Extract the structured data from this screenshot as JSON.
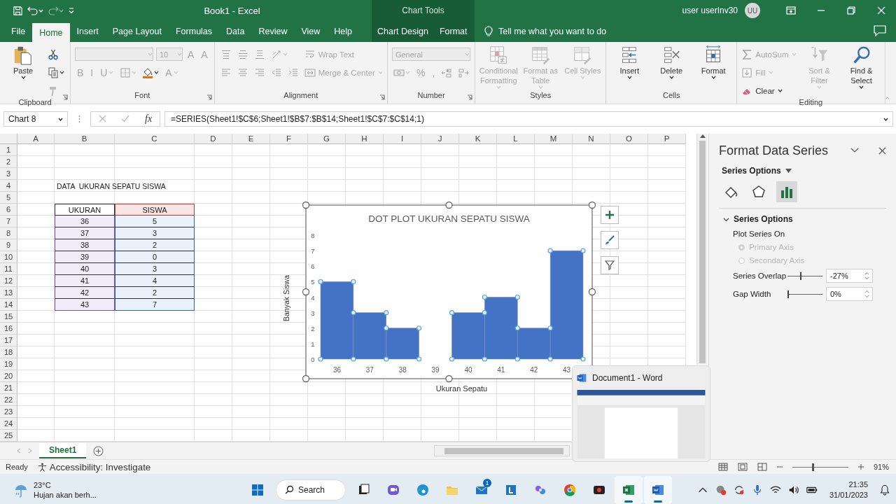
{
  "title_bar": {
    "title": "Book1  -  Excel",
    "user": "user userInv30",
    "avatar": "UU"
  },
  "tabs": [
    {
      "label": "File",
      "selected": false
    },
    {
      "label": "Home",
      "selected": true
    },
    {
      "label": "Insert",
      "selected": false
    },
    {
      "label": "Page Layout",
      "selected": false
    },
    {
      "label": "Formulas",
      "selected": false
    },
    {
      "label": "Data",
      "selected": false
    },
    {
      "label": "Review",
      "selected": false
    },
    {
      "label": "View",
      "selected": false
    },
    {
      "label": "Help",
      "selected": false
    }
  ],
  "chart_tools": {
    "label": "Chart Tools",
    "tabs": [
      {
        "label": "Chart Design",
        "selected": false
      },
      {
        "label": "Format",
        "selected": false
      }
    ]
  },
  "tell_me": {
    "placeholder": "Tell me what you want to do"
  },
  "ribbon": [
    {
      "label": "Clipboard",
      "launcher": true,
      "blocks": [
        {
          "kind": "large",
          "label": "Paste",
          "disabled": false,
          "menu": true
        },
        {
          "kind": "stack",
          "rows": [
            [
              {
                "kind": "icon",
                "disabled": false,
                "menu": false
              }
            ],
            [
              {
                "kind": "icon",
                "disabled": false,
                "menu": true
              }
            ],
            [
              {
                "kind": "icon",
                "disabled": true,
                "menu": false
              }
            ]
          ]
        }
      ]
    },
    {
      "label": "Font",
      "launcher": true,
      "blocks": [
        {
          "kind": "stack",
          "rows": [
            [
              {
                "kind": "combo",
                "disabled": true
              },
              {
                "kind": "combo",
                "label": "10",
                "disabled": true
              },
              {
                "kind": "glyph",
                "label": "A",
                "disabled": true,
                "menu": false
              },
              {
                "kind": "glyph",
                "label": "A",
                "disabled": true,
                "menu": false
              }
            ],
            [
              {
                "kind": "glyph",
                "label": "B",
                "disabled": true,
                "menu": false
              },
              {
                "kind": "glyph",
                "label": "I",
                "disabled": true,
                "menu": false
              },
              {
                "kind": "glyph",
                "label": "U",
                "disabled": true,
                "menu": true
              },
              {
                "kind": "icon",
                "disabled": true,
                "menu": true
              },
              {
                "kind": "icon",
                "disabled": false,
                "menu": true
              },
              {
                "kind": "glyph",
                "label": "A",
                "disabled": true,
                "menu": true
              }
            ]
          ]
        }
      ]
    },
    {
      "label": "Alignment",
      "launcher": true,
      "blocks": [
        {
          "kind": "stack",
          "rows": [
            [
              {
                "kind": "icon",
                "disabled": true,
                "menu": false
              },
              {
                "kind": "icon",
                "disabled": true,
                "menu": false
              },
              {
                "kind": "icon",
                "disabled": true,
                "menu": false
              },
              {
                "kind": "icon",
                "disabled": true,
                "menu": true
              }
            ],
            [
              {
                "kind": "icon",
                "disabled": true,
                "menu": false
              },
              {
                "kind": "icon",
                "disabled": true,
                "menu": false
              },
              {
                "kind": "icon",
                "disabled": true,
                "menu": false
              },
              {
                "kind": "icon",
                "disabled": true,
                "menu": false
              },
              {
                "kind": "icon",
                "disabled": true,
                "menu": false
              }
            ]
          ]
        },
        {
          "kind": "stack",
          "rows": [
            [
              {
                "kind": "small",
                "label": "Wrap Text",
                "disabled": true,
                "menu": false
              }
            ],
            [
              {
                "kind": "small",
                "label": "Merge & Center",
                "disabled": true,
                "menu": true
              }
            ]
          ]
        }
      ]
    },
    {
      "label": "Number",
      "launcher": true,
      "blocks": [
        {
          "kind": "stack",
          "rows": [
            [
              {
                "kind": "combo",
                "label": "General",
                "disabled": true
              }
            ],
            [
              {
                "kind": "icon",
                "disabled": true,
                "menu": true
              },
              {
                "kind": "glyph",
                "label": "%",
                "disabled": true,
                "menu": false
              },
              {
                "kind": "glyph",
                "label": ",",
                "disabled": true,
                "menu": false
              },
              {
                "kind": "icon",
                "disabled": true,
                "menu": false
              },
              {
                "kind": "icon",
                "disabled": true,
                "menu": false
              }
            ]
          ]
        }
      ]
    },
    {
      "label": "Styles",
      "launcher": false,
      "blocks": [
        {
          "kind": "large",
          "label": "Conditional Formatting",
          "disabled": true,
          "menu": true
        },
        {
          "kind": "large",
          "label": "Format as Table",
          "disabled": true,
          "menu": true
        },
        {
          "kind": "large",
          "label": "Cell Styles",
          "disabled": true,
          "menu": true
        }
      ]
    },
    {
      "label": "Cells",
      "launcher": false,
      "blocks": [
        {
          "kind": "large",
          "label": "Insert",
          "disabled": false,
          "menu": true
        },
        {
          "kind": "large",
          "label": "Delete",
          "disabled": false,
          "menu": true
        },
        {
          "kind": "large",
          "label": "Format",
          "disabled": false,
          "menu": true
        }
      ]
    },
    {
      "label": "Editing",
      "launcher": false,
      "blocks": [
        {
          "kind": "stack",
          "rows": [
            [
              {
                "kind": "small",
                "label": "AutoSum",
                "disabled": true,
                "menu": true
              }
            ],
            [
              {
                "kind": "small",
                "label": "Fill",
                "disabled": true,
                "menu": true
              }
            ],
            [
              {
                "kind": "small",
                "label": "Clear",
                "disabled": false,
                "menu": true
              }
            ]
          ]
        },
        {
          "kind": "large",
          "label": "Sort & Filter",
          "disabled": true,
          "menu": true
        },
        {
          "kind": "large",
          "label": "Find & Select",
          "disabled": false,
          "menu": true
        }
      ]
    }
  ],
  "formula_bar": {
    "name_box": "Chart 8",
    "fx": "fx",
    "formula": "=SERIES(Sheet1!$C$6;Sheet1!$B$7:$B$14;Sheet1!$C$7:$C$14;1)"
  },
  "sheet": {
    "columns": [
      "A",
      "B",
      "C",
      "D",
      "E",
      "F",
      "G",
      "H",
      "I",
      "J",
      "K",
      "L",
      "M",
      "N",
      "O",
      "P"
    ],
    "rows": [
      "1",
      "2",
      "3",
      "4",
      "5",
      "6",
      "7",
      "8",
      "9",
      "10",
      "11",
      "12",
      "13",
      "14",
      "15",
      "16",
      "17",
      "18",
      "19",
      "20",
      "21",
      "22",
      "23",
      "24",
      "25"
    ],
    "title_cell": "DATA  UKURAN SEPATU SISWA",
    "table": {
      "columns": [
        "UKURAN",
        "SISWA"
      ],
      "rows": [
        [
          "36",
          "5"
        ],
        [
          "37",
          "3"
        ],
        [
          "38",
          "2"
        ],
        [
          "39",
          "0"
        ],
        [
          "40",
          "3"
        ],
        [
          "41",
          "4"
        ],
        [
          "42",
          "2"
        ],
        [
          "43",
          "7"
        ]
      ]
    }
  },
  "chart": {
    "selected": true,
    "chart_data": {
      "type": "bar",
      "title": "DOT PLOT UKURAN SEPATU SISWA",
      "xlabel": "Ukuran Sepatu",
      "ylabel": "Banyak Siswa",
      "categories": [
        "36",
        "37",
        "38",
        "39",
        "40",
        "41",
        "42",
        "43"
      ],
      "series": [
        {
          "color": "#4472c4",
          "values": [
            5,
            3,
            2,
            0,
            3,
            4,
            2,
            7
          ]
        }
      ],
      "ylim": [
        0,
        8
      ],
      "yticks": [
        0,
        1,
        2,
        3,
        4,
        5,
        6,
        7,
        8
      ]
    }
  },
  "format_pane": {
    "title": "Format Data Series",
    "options_menu": "Series Options",
    "categories": [
      {
        "selected": false
      },
      {
        "selected": false
      },
      {
        "selected": true
      }
    ],
    "section": {
      "label": "Series Options",
      "expanded": true
    },
    "plot_on": "Plot Series On",
    "axes": [
      {
        "label": "Primary Axis",
        "selected": true,
        "disabled": true
      },
      {
        "label": "Secondary Axis",
        "selected": false,
        "disabled": true
      }
    ],
    "sliders": [
      {
        "label": "Series Overlap",
        "level": 0.37,
        "value": "-27%"
      },
      {
        "label": "Gap Width",
        "level": 0,
        "value": "0%"
      }
    ]
  },
  "sheet_tabs": [
    {
      "label": "Sheet1",
      "selected": true
    }
  ],
  "status_bar": {
    "mode": "Ready",
    "accessibility": "Accessibility: Investigate",
    "zoom": "91%",
    "zoom_slider": {
      "level": 0.37
    }
  },
  "word_preview": {
    "title": "Document1 - Word"
  },
  "taskbar": {
    "weather": {
      "temperature": "23°C",
      "forecast": "Hujan akan berh..."
    },
    "search": {
      "label": "Search"
    },
    "apps": [
      {
        "active": false
      },
      {
        "active": false
      },
      {
        "active": false
      },
      {
        "active": false
      },
      {
        "active": false
      },
      {
        "active": false,
        "badge": "1"
      },
      {
        "active": false
      },
      {
        "active": false
      },
      {
        "active": false
      },
      {
        "active": false
      },
      {
        "active": true
      },
      {
        "active": true
      }
    ],
    "time": "21:35",
    "date": "31/01/2023"
  }
}
